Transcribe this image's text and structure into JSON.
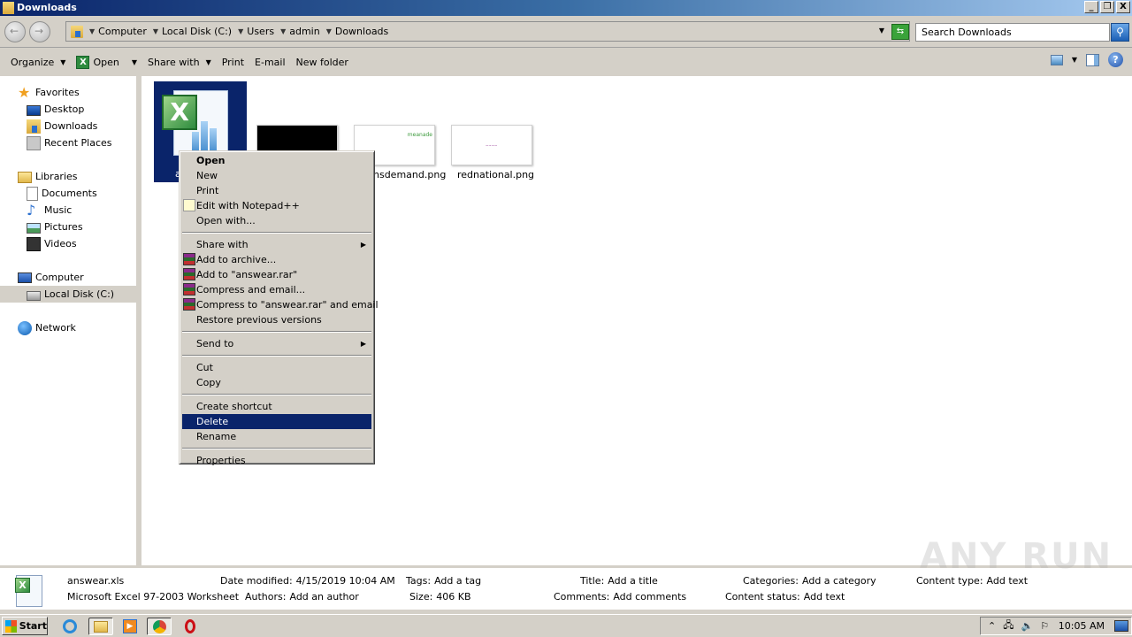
{
  "window": {
    "title": "Downloads",
    "controls": {
      "minimize": "_",
      "restore": "❐",
      "close": "X"
    }
  },
  "address": {
    "breadcrumbs": [
      "Computer",
      "Local Disk (C:)",
      "Users",
      "admin",
      "Downloads"
    ],
    "search_placeholder": "Search Downloads"
  },
  "toolbar": {
    "organize": "Organize",
    "open": "Open",
    "share_with": "Share with",
    "print": "Print",
    "email": "E-mail",
    "new_folder": "New folder"
  },
  "navpane": {
    "favorites": {
      "label": "Favorites",
      "items": [
        "Desktop",
        "Downloads",
        "Recent Places"
      ]
    },
    "libraries": {
      "label": "Libraries",
      "items": [
        "Documents",
        "Music",
        "Pictures",
        "Videos"
      ]
    },
    "computer": {
      "label": "Computer",
      "items": [
        "Local Disk (C:)"
      ]
    },
    "network": {
      "label": "Network"
    }
  },
  "files": [
    {
      "name": "answear.xls",
      "visible_label": "a",
      "type": "xls",
      "selected": true
    },
    {
      "name": "",
      "type": "png-black"
    },
    {
      "name": "nsdemand.png",
      "type": "png",
      "thumb_text": "meanade"
    },
    {
      "name": "rednational.png",
      "type": "png",
      "thumb_text": "~~~~"
    }
  ],
  "context_menu": {
    "items": [
      {
        "label": "Open",
        "bold": true
      },
      {
        "label": "New"
      },
      {
        "label": "Print"
      },
      {
        "label": "Edit with Notepad++",
        "icon": "notepadpp-icon"
      },
      {
        "label": "Open with..."
      },
      {
        "separator": true
      },
      {
        "label": "Share with",
        "submenu": true
      },
      {
        "label": "Add to archive...",
        "icon": "winrar-icon"
      },
      {
        "label": "Add to \"answear.rar\"",
        "icon": "winrar-icon"
      },
      {
        "label": "Compress and email...",
        "icon": "winrar-icon"
      },
      {
        "label": "Compress to \"answear.rar\" and email",
        "icon": "winrar-icon"
      },
      {
        "label": "Restore previous versions"
      },
      {
        "separator": true
      },
      {
        "label": "Send to",
        "submenu": true
      },
      {
        "separator": true
      },
      {
        "label": "Cut"
      },
      {
        "label": "Copy"
      },
      {
        "separator": true
      },
      {
        "label": "Create shortcut"
      },
      {
        "label": "Delete",
        "highlighted": true
      },
      {
        "label": "Rename"
      },
      {
        "separator": true
      },
      {
        "label": "Properties"
      }
    ]
  },
  "details": {
    "filename": "answear.xls",
    "filetype": "Microsoft Excel 97-2003 Worksheet",
    "date_modified_label": "Date modified:",
    "date_modified": "4/15/2019 10:04 AM",
    "authors_label": "Authors:",
    "authors": "Add an author",
    "tags_label": "Tags:",
    "tags": "Add a tag",
    "size_label": "Size:",
    "size": "406 KB",
    "title_label": "Title:",
    "title": "Add a title",
    "comments_label": "Comments:",
    "comments": "Add comments",
    "categories_label": "Categories:",
    "categories": "Add a category",
    "content_status_label": "Content status:",
    "content_status": "Add text",
    "content_type_label": "Content type:",
    "content_type": "Add text"
  },
  "watermark": "ANY RUN",
  "taskbar": {
    "start": "Start",
    "clock": "10:05 AM"
  }
}
